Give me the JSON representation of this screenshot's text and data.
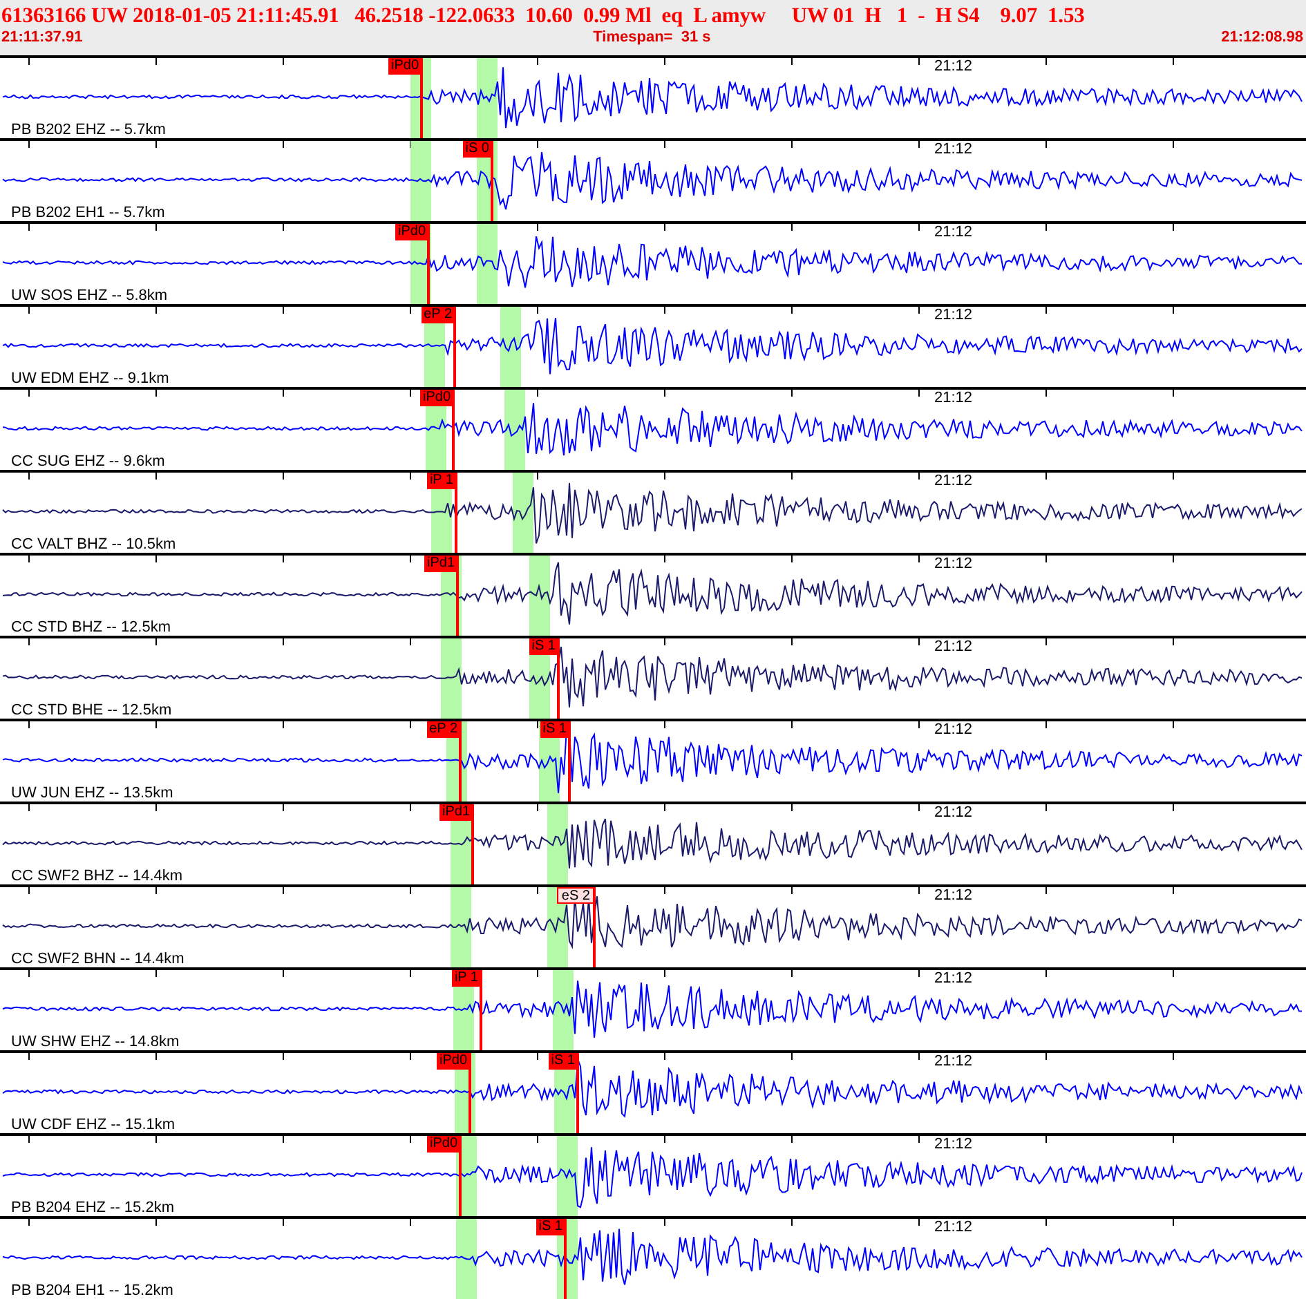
{
  "header": {
    "event_line": "61363166 UW 2018-01-05 21:11:45.91   46.2518 -122.0633  10.60  0.99 Ml  eq  L amyw     UW 01  H   1  -  H S4    9.07  1.53",
    "start_time": "21:11:37.91",
    "timespan": "Timespan=  31 s",
    "end_time": "21:12:08.98"
  },
  "traces": [
    {
      "station": "PB B202 EHZ -- 5.7km",
      "time_label": "21:12",
      "color": "#0000ff",
      "picks": [
        {
          "label": "iPd0",
          "kind": "filled"
        }
      ]
    },
    {
      "station": "PB B202 EH1 -- 5.7km",
      "time_label": "21:12",
      "color": "#0000ff",
      "picks": [
        {
          "label": "iS 0",
          "kind": "filled"
        }
      ]
    },
    {
      "station": "UW SOS EHZ -- 5.8km",
      "time_label": "21:12",
      "color": "#0000ff",
      "picks": [
        {
          "label": "iPd0",
          "kind": "filled"
        }
      ]
    },
    {
      "station": "UW EDM EHZ -- 9.1km",
      "time_label": "21:12",
      "color": "#0000ff",
      "picks": [
        {
          "label": "eP 2",
          "kind": "filled"
        }
      ]
    },
    {
      "station": "CC SUG EHZ -- 9.6km",
      "time_label": "21:12",
      "color": "#0000ff",
      "picks": [
        {
          "label": "iPd0",
          "kind": "filled"
        }
      ]
    },
    {
      "station": "CC VALT BHZ -- 10.5km",
      "time_label": "21:12",
      "color": "#1c1a6b",
      "picks": [
        {
          "label": "iP 1",
          "kind": "filled"
        }
      ]
    },
    {
      "station": "CC STD BHZ -- 12.5km",
      "time_label": "21:12",
      "color": "#1c1a6b",
      "picks": [
        {
          "label": "iPd1",
          "kind": "filled"
        }
      ]
    },
    {
      "station": "CC STD BHE -- 12.5km",
      "time_label": "21:12",
      "color": "#1c1a6b",
      "picks": [
        {
          "label": "iS 1",
          "kind": "filled"
        }
      ]
    },
    {
      "station": "UW JUN EHZ -- 13.5km",
      "time_label": "21:12",
      "color": "#0000ff",
      "picks": [
        {
          "label": "eP 2",
          "kind": "filled"
        },
        {
          "label": "iS 1",
          "kind": "filled"
        }
      ]
    },
    {
      "station": "CC SWF2 BHZ -- 14.4km",
      "time_label": "21:12",
      "color": "#1c1a6b",
      "picks": [
        {
          "label": "iPd1",
          "kind": "filled"
        }
      ]
    },
    {
      "station": "CC SWF2 BHN -- 14.4km",
      "time_label": "21:12",
      "color": "#1c1a6b",
      "picks": [
        {
          "label": "eS 2",
          "kind": "outlined"
        }
      ]
    },
    {
      "station": "UW SHW EHZ -- 14.8km",
      "time_label": "21:12",
      "color": "#0000ff",
      "picks": [
        {
          "label": "iP 1",
          "kind": "filled"
        }
      ]
    },
    {
      "station": "UW CDF EHZ -- 15.1km",
      "time_label": "21:12",
      "color": "#0000ff",
      "picks": [
        {
          "label": "iPd0",
          "kind": "filled"
        },
        {
          "label": "iS 1",
          "kind": "filled"
        }
      ]
    },
    {
      "station": "PB B204 EHZ -- 15.2km",
      "time_label": "21:12",
      "color": "#0000ff",
      "picks": [
        {
          "label": "iPd0",
          "kind": "filled"
        }
      ]
    },
    {
      "station": "PB B204 EH1 -- 15.2km",
      "time_label": "21:12",
      "color": "#0000ff",
      "picks": [
        {
          "label": "iS 1",
          "kind": "filled"
        }
      ]
    }
  ]
}
